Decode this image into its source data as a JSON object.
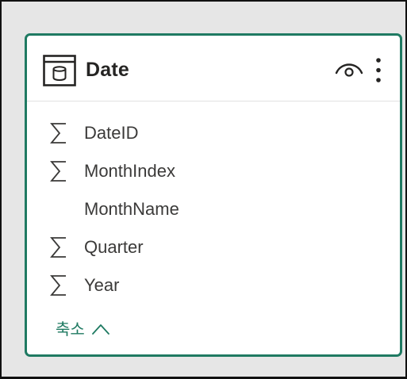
{
  "card": {
    "title": "Date",
    "icon": "table-icon",
    "actions": [
      "eye-icon",
      "more-vertical-icon"
    ]
  },
  "fields": [
    {
      "label": "DateID",
      "icon": "sigma-icon"
    },
    {
      "label": "MonthIndex",
      "icon": "sigma-icon"
    },
    {
      "label": "MonthName",
      "icon": null
    },
    {
      "label": "Quarter",
      "icon": "sigma-icon"
    },
    {
      "label": "Year",
      "icon": "sigma-icon"
    }
  ],
  "collapse": {
    "label": "축소",
    "icon": "chevron-up-icon"
  },
  "colors": {
    "accent": "#1f7a62",
    "text": "#252423",
    "background": "#e6e6e6"
  }
}
